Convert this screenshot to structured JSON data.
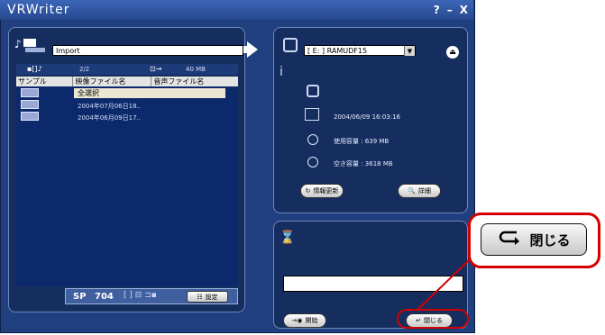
{
  "window": {
    "title": "VRWriter",
    "controls": [
      "?",
      "–",
      "X"
    ]
  },
  "source": {
    "folder_field": "Import",
    "summary_count": "2/2",
    "summary_size": "40 MB",
    "columns": [
      "サンプル",
      "映像ファイル名",
      "音声ファイル名"
    ],
    "select_all_label": "全選択",
    "rows": [
      {
        "video": "2004年07月06日18.."
      },
      {
        "video": "2004年06月09日17.."
      }
    ],
    "mode_label": "SP",
    "mode_value": "704",
    "settings_label": "設定"
  },
  "target": {
    "drive_select": "[ E: ] RAMUDF15",
    "datetime": "2004/06/09 16:03:16",
    "used_label": "使用容量 : 639 MB",
    "free_label": "空き容量 : 3618 MB",
    "refresh_button": "情報更新",
    "detail_button": "詳細"
  },
  "bottom": {
    "start_button": "開始",
    "close_button": "閉じる"
  },
  "callout": {
    "close_button_zoom": "閉じる"
  },
  "colors": {
    "window_bg": "#1f3f7e",
    "panel_bg": "#162e5f",
    "callout_border": "#d40000"
  }
}
